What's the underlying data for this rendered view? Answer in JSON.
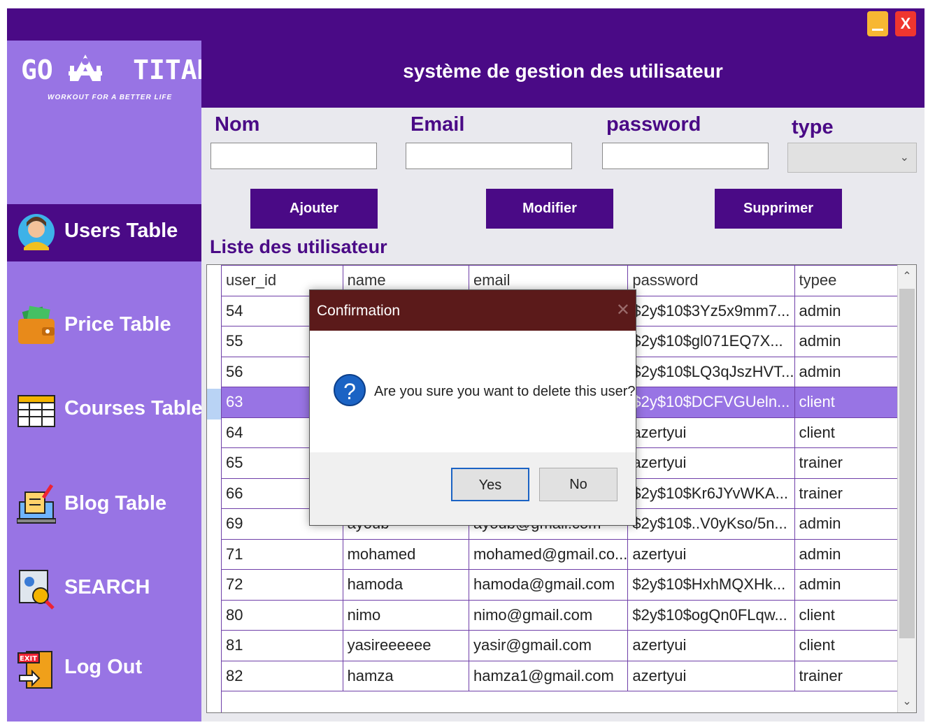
{
  "window": {
    "minimize_icon": "minimize-icon",
    "close_label": "X"
  },
  "logo": {
    "main": "GO     TITANS",
    "tagline": "WORKOUT FOR A BETTER LIFE"
  },
  "sidebar": {
    "items": [
      {
        "label": "Users Table",
        "icon": "user-avatar-icon"
      },
      {
        "label": "Price Table",
        "icon": "wallet-icon"
      },
      {
        "label": "Courses Table",
        "icon": "table-icon"
      },
      {
        "label": "Blog Table",
        "icon": "blog-icon"
      },
      {
        "label": "SEARCH",
        "icon": "search-doc-icon"
      },
      {
        "label": "Log Out",
        "icon": "exit-door-icon"
      }
    ]
  },
  "header": {
    "title": "système de gestion des utilisateur"
  },
  "form": {
    "nom_label": "Nom",
    "email_label": "Email",
    "password_label": "password",
    "type_label": "type",
    "nom_value": "",
    "email_value": "",
    "password_value": "",
    "type_value": ""
  },
  "actions": {
    "add": "Ajouter",
    "edit": "Modifier",
    "delete": "Supprimer"
  },
  "list": {
    "title": "Liste des utilisateur",
    "columns": [
      "user_id",
      "name",
      "email",
      "password",
      "typee"
    ],
    "rows": [
      [
        "54",
        "",
        "",
        "$2y$10$3Yz5x9mm7...",
        "admin"
      ],
      [
        "55",
        "",
        "",
        "$2y$10$gl071EQ7X...",
        "admin"
      ],
      [
        "56",
        "",
        "",
        "$2y$10$LQ3qJszHVT...",
        "admin"
      ],
      [
        "63",
        "",
        "",
        "$2y$10$DCFVGUeln...",
        "client"
      ],
      [
        "64",
        "",
        "",
        "azertyui",
        "client"
      ],
      [
        "65",
        "",
        "",
        "azertyui",
        "trainer"
      ],
      [
        "66",
        "",
        "",
        "$2y$10$Kr6JYvWKA...",
        "trainer"
      ],
      [
        "69",
        "ayoub",
        "ayoub@gmail.com",
        "$2y$10$..V0yKso/5n...",
        "admin"
      ],
      [
        "71",
        "mohamed",
        "mohamed@gmail.co...",
        "azertyui",
        "admin"
      ],
      [
        "72",
        "hamoda",
        "hamoda@gmail.com",
        "$2y$10$HxhMQXHk...",
        "admin"
      ],
      [
        "80",
        "nimo",
        "nimo@gmail.com",
        "$2y$10$ogQn0FLqw...",
        "client"
      ],
      [
        "81",
        "yasireeeeee",
        "yasir@gmail.com",
        "azertyui",
        "client"
      ],
      [
        "82",
        "hamza",
        "hamza1@gmail.com",
        "azertyui",
        "trainer"
      ]
    ],
    "selected_row": 3
  },
  "dialog": {
    "title": "Confirmation",
    "message": "Are you sure you want to delete this user?",
    "icon": "question-icon",
    "yes": "Yes",
    "no": "No"
  },
  "colors": {
    "primary": "#4a0a86",
    "sidebar": "#9874e4",
    "dialog_header": "#5b1a1a"
  }
}
